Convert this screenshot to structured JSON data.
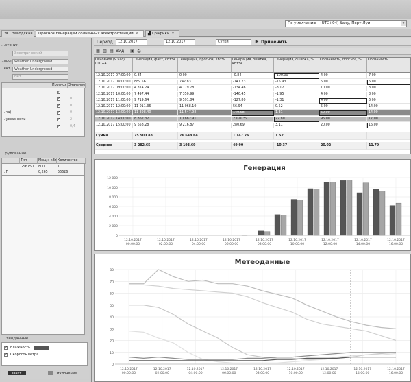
{
  "window": {
    "timezone": "По умолчанию - (UTC+04) Баку, Порт-Луи",
    "tabs": [
      {
        "label": "ЭС: Заводская",
        "active": false
      },
      {
        "label": "Прогноз генерации солнечных электростанций",
        "active": true
      },
      {
        "label": "Графики",
        "active": false
      }
    ]
  },
  "left_panel": {
    "section1_title": "...этоник",
    "field1": "Электрический",
    "label2": "...прогноз",
    "field2": "Weather Underground",
    "label3": "...ект",
    "field3": "Weather Underground",
    "field4": "Нет",
    "params_headers": [
      "Прогноз",
      "Значение"
    ],
    "params_rows": [
      {
        "label": "",
        "checked": true,
        "value": ""
      },
      {
        "label": "",
        "checked": true,
        "value": "0"
      },
      {
        "label": "",
        "checked": true,
        "value": "0"
      },
      {
        "label": "...ча)",
        "checked": true,
        "value": "0"
      },
      {
        "label": "...усравности",
        "checked": true,
        "value": "2"
      },
      {
        "label": "",
        "checked": true,
        "value": "0,4"
      }
    ],
    "section2_title": "...рудование",
    "equip_headers": [
      "",
      "Тип",
      "Мощн. кВт",
      "Количество"
    ],
    "equip_rows": [
      {
        "name": "",
        "type": "GS6750",
        "power": "800",
        "count": "1"
      },
      {
        "name": "...П",
        "type": "",
        "power": "0,265",
        "count": "56626"
      }
    ],
    "legend_title": "...теоданные",
    "legend_items": [
      {
        "label": "Влажность",
        "checked": true
      },
      {
        "label": "Скорость ветра",
        "checked": true
      }
    ],
    "legend_bottom": [
      "Факт",
      "Отклонение"
    ],
    "colors": {
      "legend_dark": "#555555",
      "legend_mid": "#333333"
    }
  },
  "toolbar": {
    "period_label": "Период",
    "date_from": "12.10.2017",
    "date_to": "12.10.2017",
    "granularity": "Сутки",
    "apply_label": "Применить",
    "view_label": "Вид"
  },
  "table": {
    "headers": [
      "Основное (Ч час) UTC+4",
      "Генерация, факт, кВт*ч",
      "Генерация, прогноз, кВт*ч",
      "Генерация, ошибка, кВт*ч",
      "Генерация, ошибка, %",
      "Облачность, прогноз, %",
      "Облачность"
    ],
    "rows": [
      [
        "12.10.2017 07:00:00",
        "0.84",
        "0.00",
        "-0.84",
        "-100.00",
        "4.00",
        "7.00"
      ],
      [
        "12.10.2017 08:00:00",
        "889.56",
        "747.83",
        "-141.73",
        "-15.93",
        "5.00",
        "6.00"
      ],
      [
        "12.10.2017 09:00:00",
        "4 314.24",
        "4 179.78",
        "-134.46",
        "-3.12",
        "10.00",
        "8.00"
      ],
      [
        "12.10.2017 10:00:00",
        "7 497.44",
        "7 350.99",
        "-146.45",
        "-1.95",
        "4.00",
        "8.00"
      ],
      [
        "12.10.2017 11:00:00",
        "9 719.64",
        "9 591.84",
        "-127.80",
        "-1.31",
        "4.00",
        "6.00"
      ],
      [
        "12.10.2017 12:00:00",
        "11 011.36",
        "11 068.10",
        "56.94",
        "0.52",
        "5.00",
        "14.00"
      ],
      [
        "12.10.2017 13:00:00",
        "11 398.40",
        "11 547.98",
        "149.58",
        "1.31",
        "60.00",
        "14.00"
      ],
      [
        "12.10.2017 14:00:00",
        "8 862.32",
        "10 882.91",
        "2 020.59",
        "22.80",
        "96.00",
        "17.00"
      ],
      [
        "12.10.2017 15:00:00",
        "9 658.28",
        "9 216.87",
        "280.69",
        "3.11",
        "20.00",
        "16.00"
      ]
    ],
    "sum_label": "Сумма",
    "sum_values": [
      "75 500.88",
      "76 648.64",
      "1 147.76",
      "1.52",
      "",
      ""
    ],
    "avg_label": "Среднее",
    "avg_values": [
      "3 282.65",
      "3 193.69",
      "49.90",
      "-10.37",
      "20.02",
      "11.79"
    ]
  },
  "chart_data": [
    {
      "type": "bar",
      "title": "Генерация",
      "y_ticks": [
        "12 000",
        "10 000",
        "8 000",
        "6 000",
        "4 000",
        "2 000",
        "0"
      ],
      "ylim": [
        0,
        12000
      ],
      "x_tick_labels": [
        [
          "12.10.2017",
          "00:00:00"
        ],
        [
          "12.10.2017",
          "02:00:00"
        ],
        [
          "12.10.2017",
          "04:00:00"
        ],
        [
          "12.10.2017",
          "06:00:00"
        ],
        [
          "12.10.2017",
          "08:00:00"
        ],
        [
          "12.10.2017",
          "10:00:00"
        ],
        [
          "12.10.2017",
          "12:00:00"
        ],
        [
          "12.10.2017",
          "14:00:00"
        ],
        [
          "12.10.2017",
          "16:00:00"
        ]
      ],
      "x_hours": [
        6,
        7,
        8,
        9,
        10,
        11,
        12,
        13,
        14,
        15,
        16
      ],
      "series": [
        {
          "values": [
            0,
            1,
            890,
            4314,
            7497,
            9720,
            11011,
            11398,
            8862,
            9658,
            6200
          ]
        },
        {
          "values": [
            0,
            0,
            748,
            4180,
            7351,
            9592,
            11068,
            11548,
            10883,
            9217,
            6700
          ]
        }
      ],
      "colors": [
        "#555555",
        "#a6a6a6"
      ]
    },
    {
      "type": "line",
      "title": "Метеоданные",
      "y_ticks": [
        "80",
        "70",
        "60",
        "50",
        "40",
        "30",
        "20",
        "10",
        "0"
      ],
      "ylim": [
        0,
        80
      ],
      "x_tick_labels": [
        [
          "12.10.2017",
          "00:00:00"
        ],
        [
          "12.10.2017",
          "02:00:00"
        ],
        [
          "12.10.2017",
          "04:00:00"
        ],
        [
          "12.10.2017",
          "06:00:00"
        ],
        [
          "12.10.2017",
          "08:00:00"
        ],
        [
          "12.10.2017",
          "10:00:00"
        ],
        [
          "12.10.2017",
          "12:00:00"
        ],
        [
          "12.10.2017",
          "14:00:00"
        ],
        [
          "12.10.2017",
          "16:00:00"
        ]
      ],
      "x": [
        0,
        1,
        2,
        3,
        4,
        5,
        6,
        7,
        8,
        9,
        10,
        11,
        12,
        13,
        14,
        15,
        16,
        17,
        18
      ],
      "series": [
        {
          "values": [
            68,
            68,
            80,
            74,
            70,
            71,
            68,
            68,
            66,
            62,
            59,
            56,
            50,
            45,
            40,
            36,
            33,
            31,
            30
          ],
          "color": "#bdbdbd"
        },
        {
          "values": [
            67,
            67,
            66,
            64,
            63,
            62,
            61,
            60,
            57,
            52,
            48,
            44,
            38,
            34,
            32,
            30,
            28,
            24,
            20
          ],
          "color": "#d0d0d0"
        },
        {
          "values": [
            50,
            50,
            48,
            42,
            34,
            28,
            22,
            14,
            8,
            6,
            5,
            5,
            4,
            4,
            5,
            6,
            8,
            9,
            10
          ],
          "color": "#c8c8c8"
        },
        {
          "values": [
            28,
            27,
            22,
            18,
            10,
            4,
            2,
            1,
            1,
            1,
            1,
            2,
            3,
            4,
            6,
            7,
            8,
            8,
            9
          ],
          "color": "#e0e0e0"
        },
        {
          "values": [
            6,
            5,
            6,
            5,
            4,
            4,
            4,
            4,
            5,
            5,
            6,
            6,
            7,
            8,
            9,
            10,
            10,
            10,
            10
          ],
          "color": "#8c8c8c"
        },
        {
          "values": [
            3,
            3,
            3,
            3,
            3,
            3,
            3,
            3,
            3,
            3,
            4,
            4,
            5,
            5,
            5,
            6,
            6,
            6,
            6
          ],
          "color": "#5a5a5a"
        }
      ]
    }
  ]
}
